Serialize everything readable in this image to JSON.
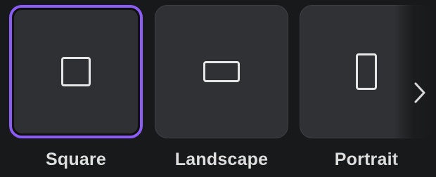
{
  "options": [
    {
      "label": "Square",
      "selected": true
    },
    {
      "label": "Landscape",
      "selected": false
    },
    {
      "label": "Portrait",
      "selected": false
    }
  ],
  "icons": {
    "square": "square-shape-icon",
    "landscape": "landscape-rectangle-icon",
    "portrait": "portrait-rectangle-icon",
    "next": "chevron-right-icon"
  },
  "colors": {
    "background": "#18191b",
    "tile": "#303134",
    "selected_border": "#8b5cf6",
    "icon_stroke": "#e6e6e6",
    "label_text": "#dedede"
  }
}
